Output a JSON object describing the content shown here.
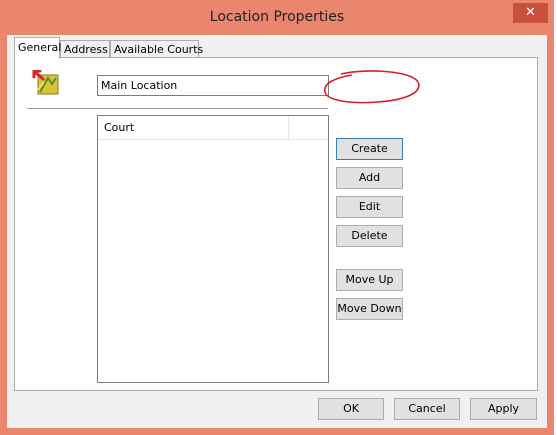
{
  "window": {
    "title": "Location Properties",
    "close_glyph": "✕"
  },
  "tabs": [
    "General",
    "Address",
    "Available Courts"
  ],
  "general": {
    "name_value": "Main Location",
    "list_column": "Court"
  },
  "side_buttons": {
    "create": "Create",
    "add": "Add",
    "edit": "Edit",
    "delete": "Delete",
    "move_up": "Move Up",
    "move_down": "Move Down"
  },
  "footer_buttons": {
    "ok": "OK",
    "cancel": "Cancel",
    "apply": "Apply"
  },
  "icons": {
    "location_icon": "location-edit-icon"
  },
  "colors": {
    "titlebar": "#e9866d",
    "close_button": "#c7503f",
    "annotation": "#d4202a"
  }
}
